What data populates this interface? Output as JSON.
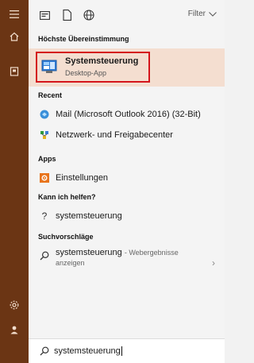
{
  "rail": {
    "icons": [
      "hamburger-menu-icon",
      "home-icon",
      "notebook-icon",
      "settings-icon",
      "user-icon"
    ],
    "accent": "#6b3514"
  },
  "toolbar": {
    "icons": [
      "apps-filter-icon",
      "documents-filter-icon",
      "web-filter-icon"
    ],
    "filter_label": "Filter"
  },
  "sections": {
    "best_match": "Höchste Übereinstimmung",
    "recent": "Recent",
    "apps": "Apps",
    "help": "Kann ich helfen?",
    "suggestions": "Suchvorschläge"
  },
  "best_match": {
    "title": "Systemsteuerung",
    "subtitle": "Desktop-App",
    "icon": "control-panel-icon",
    "highlight_color": "#d4151c"
  },
  "recent": [
    {
      "label": "Mail (Microsoft Outlook 2016) (32-Bit)",
      "icon": "mail-icon"
    },
    {
      "label": "Netzwerk- und Freigabecenter",
      "icon": "network-icon"
    }
  ],
  "apps": [
    {
      "label": "Einstellungen",
      "icon": "settings-app-icon"
    }
  ],
  "help": [
    {
      "label": "systemsteuerung",
      "icon": "question-icon"
    }
  ],
  "suggestions": [
    {
      "label": "systemsteuerung",
      "suffix": "- Webergebnisse",
      "line2": "anzeigen",
      "icon": "search-icon"
    }
  ],
  "search": {
    "value": "systemsteuerung",
    "icon": "search-icon"
  }
}
